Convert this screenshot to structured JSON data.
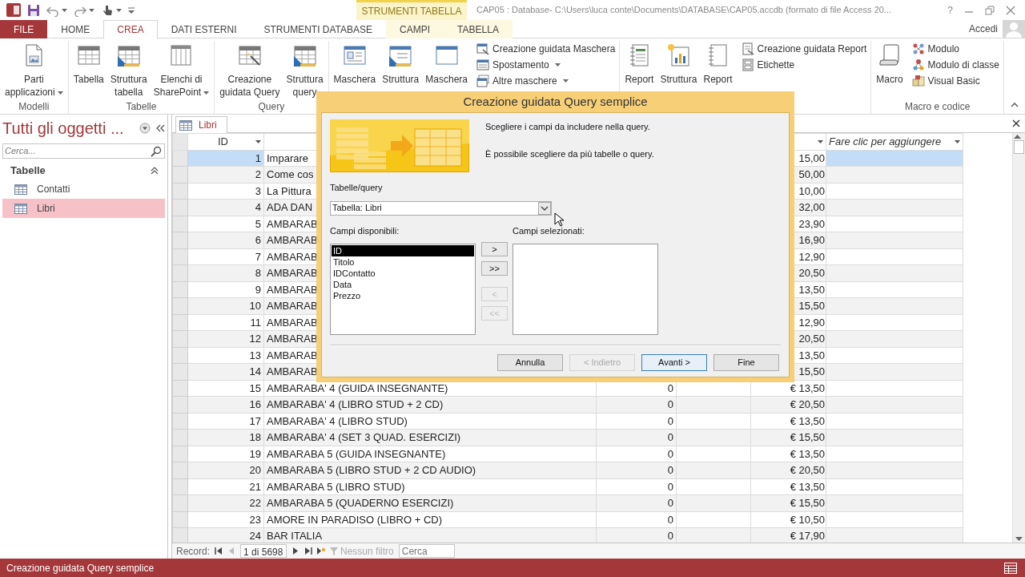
{
  "title_bar": {
    "contextual_group": "STRUMENTI TABELLA",
    "title": "CAP05 : Database- C:\\Users\\luca conte\\Documents\\DATABASE\\CAP05.accdb (formato di file Access 20...",
    "help": "?"
  },
  "tabs": [
    {
      "label": "FILE",
      "kind": "file",
      "selected": false
    },
    {
      "label": "HOME",
      "kind": "main",
      "selected": false
    },
    {
      "label": "CREA",
      "kind": "main",
      "selected": true
    },
    {
      "label": "DATI ESTERNI",
      "kind": "main",
      "selected": false
    },
    {
      "label": "STRUMENTI DATABASE",
      "kind": "main",
      "selected": false
    },
    {
      "label": "CAMPI",
      "kind": "contextual",
      "selected": false
    },
    {
      "label": "TABELLA",
      "kind": "contextual",
      "selected": false
    }
  ],
  "account": {
    "label": "Accedi"
  },
  "ribbon": {
    "groups": [
      {
        "label": "Modelli",
        "large": [
          {
            "label": "Parti\napplicazioni",
            "dropdown": true
          }
        ]
      },
      {
        "label": "Tabelle",
        "large": [
          {
            "label": "Tabella"
          },
          {
            "label": "Struttura\ntabella"
          },
          {
            "label": "Elenchi di\nSharePoint",
            "dropdown": true
          }
        ]
      },
      {
        "label": "Query",
        "large": [
          {
            "label": "Creazione\nguidata Query"
          },
          {
            "label": "Struttura\nquery"
          }
        ]
      },
      {
        "large": [
          {
            "label": "Maschera"
          },
          {
            "label": "Struttura"
          },
          {
            "label": "Maschera"
          }
        ],
        "small": [
          {
            "label": "Creazione guidata Maschera"
          },
          {
            "label": "Spostamento",
            "dropdown": true
          },
          {
            "label": "Altre maschere",
            "dropdown": true
          }
        ]
      },
      {
        "large": [
          {
            "label": "Report"
          },
          {
            "label": "Struttura"
          },
          {
            "label": "Report"
          }
        ],
        "small": [
          {
            "label": "Creazione guidata Report"
          },
          {
            "label": "Etichette"
          }
        ]
      },
      {
        "label": "Macro e codice",
        "large": [
          {
            "label": "Macro"
          }
        ],
        "small": [
          {
            "label": "Modulo"
          },
          {
            "label": "Modulo di classe"
          },
          {
            "label": "Visual Basic"
          }
        ]
      }
    ]
  },
  "nav_pane": {
    "title": "Tutti gli oggetti ...",
    "search": {
      "placeholder": "Cerca..."
    },
    "groups": [
      {
        "label": "Tabelle",
        "expanded": true,
        "items": [
          {
            "label": "Contatti",
            "selected": false
          },
          {
            "label": "Libri",
            "selected": true
          }
        ]
      }
    ]
  },
  "document_tab": {
    "label": "Libri"
  },
  "table": {
    "id_column": "ID",
    "add_column": "Fare clic per aggiungere",
    "rows": [
      {
        "id": "1",
        "title": "Imparare",
        "price": "15,00",
        "selected": true
      },
      {
        "id": "2",
        "title": "Come cos",
        "price": "50,00",
        "selected": false
      },
      {
        "id": "3",
        "title": "La Pittura",
        "price": "10,00",
        "selected": false
      },
      {
        "id": "4",
        "title": "ADA DAN",
        "price": "32,00",
        "selected": false
      },
      {
        "id": "5",
        "title": "AMBARAB",
        "price": "23,90",
        "selected": false
      },
      {
        "id": "6",
        "title": "AMBARAB",
        "price": "16,90",
        "selected": false
      },
      {
        "id": "7",
        "title": "AMBARAB",
        "price": "12,90",
        "selected": false
      },
      {
        "id": "8",
        "title": "AMBARAB",
        "price": "20,50",
        "selected": false
      },
      {
        "id": "9",
        "title": "AMBARAB",
        "price": "13,50",
        "selected": false
      },
      {
        "id": "10",
        "title": "AMBARAB",
        "price": "15,50",
        "selected": false
      },
      {
        "id": "11",
        "title": "AMBARAB",
        "price": "12,90",
        "selected": false
      },
      {
        "id": "12",
        "title": "AMBARAB",
        "price": "20,50",
        "selected": false
      },
      {
        "id": "13",
        "title": "AMBARAB",
        "price": "13,50",
        "selected": false
      },
      {
        "id": "14",
        "title": "AMBARAB",
        "price": "15,50",
        "selected": false
      },
      {
        "id": "15",
        "title": "AMBARABA' 4 (GUIDA INSEGNANTE)",
        "contact_id": "0",
        "price": "€ 13,50",
        "selected": false
      },
      {
        "id": "16",
        "title": "AMBARABA' 4 (LIBRO STUD + 2 CD)",
        "contact_id": "0",
        "price": "€ 20,50",
        "selected": false
      },
      {
        "id": "17",
        "title": "AMBARABA' 4 (LIBRO STUD)",
        "contact_id": "0",
        "price": "€ 13,50",
        "selected": false
      },
      {
        "id": "18",
        "title": "AMBARABA' 4 (SET 3 QUAD. ESERCIZI)",
        "contact_id": "0",
        "price": "€ 15,50",
        "selected": false
      },
      {
        "id": "19",
        "title": "AMBARABA 5 (GUIDA INSEGNANTE)",
        "contact_id": "0",
        "price": "€ 13,50",
        "selected": false
      },
      {
        "id": "20",
        "title": "AMBARABA 5 (LIBRO STUD + 2 CD AUDIO)",
        "contact_id": "0",
        "price": "€ 20,50",
        "selected": false
      },
      {
        "id": "21",
        "title": "AMBARABA 5 (LIBRO STUD)",
        "contact_id": "0",
        "price": "€ 13,50",
        "selected": false
      },
      {
        "id": "22",
        "title": "AMBARABA 5 (QUADERNO ESERCIZI)",
        "contact_id": "0",
        "price": "€ 15,50",
        "selected": false
      },
      {
        "id": "23",
        "title": "AMORE IN PARADISO (LIBRO + CD)",
        "contact_id": "0",
        "price": "€ 10,50",
        "selected": false
      },
      {
        "id": "24",
        "title": "BAR ITALIA",
        "contact_id": "0",
        "price": "€ 17,90",
        "selected": false
      }
    ]
  },
  "record_nav": {
    "label": "Record:",
    "position": "1 di 5698",
    "filter": "Nessun filtro",
    "search": {
      "placeholder": "Cerca"
    }
  },
  "status_bar": {
    "text": "Creazione guidata Query semplice"
  },
  "dialog": {
    "title": "Creazione guidata Query semplice",
    "intro": [
      "Scegliere i campi da includere nella query.",
      "È possibile scegliere da più tabelle o query."
    ],
    "source_label": "Tabelle/query",
    "source_value": "Tabella: Libri",
    "available_label": "Campi disponibili:",
    "available": [
      {
        "label": "ID",
        "selected": true
      },
      {
        "label": "Titolo",
        "selected": false
      },
      {
        "label": "IDContatto",
        "selected": false
      },
      {
        "label": "Data",
        "selected": false
      },
      {
        "label": "Prezzo",
        "selected": false
      }
    ],
    "selected_label": "Campi selezionati:",
    "move_buttons": [
      {
        "label": ">",
        "disabled": false
      },
      {
        "label": ">>",
        "disabled": false
      },
      {
        "label": "<",
        "disabled": true
      },
      {
        "label": "<<",
        "disabled": true
      }
    ],
    "buttons": [
      {
        "label": "Annulla",
        "disabled": false,
        "default": false
      },
      {
        "label": "< Indietro",
        "disabled": true,
        "default": false
      },
      {
        "label": "Avanti >",
        "disabled": false,
        "default": true
      },
      {
        "label": "Fine",
        "disabled": false,
        "default": false
      }
    ]
  }
}
